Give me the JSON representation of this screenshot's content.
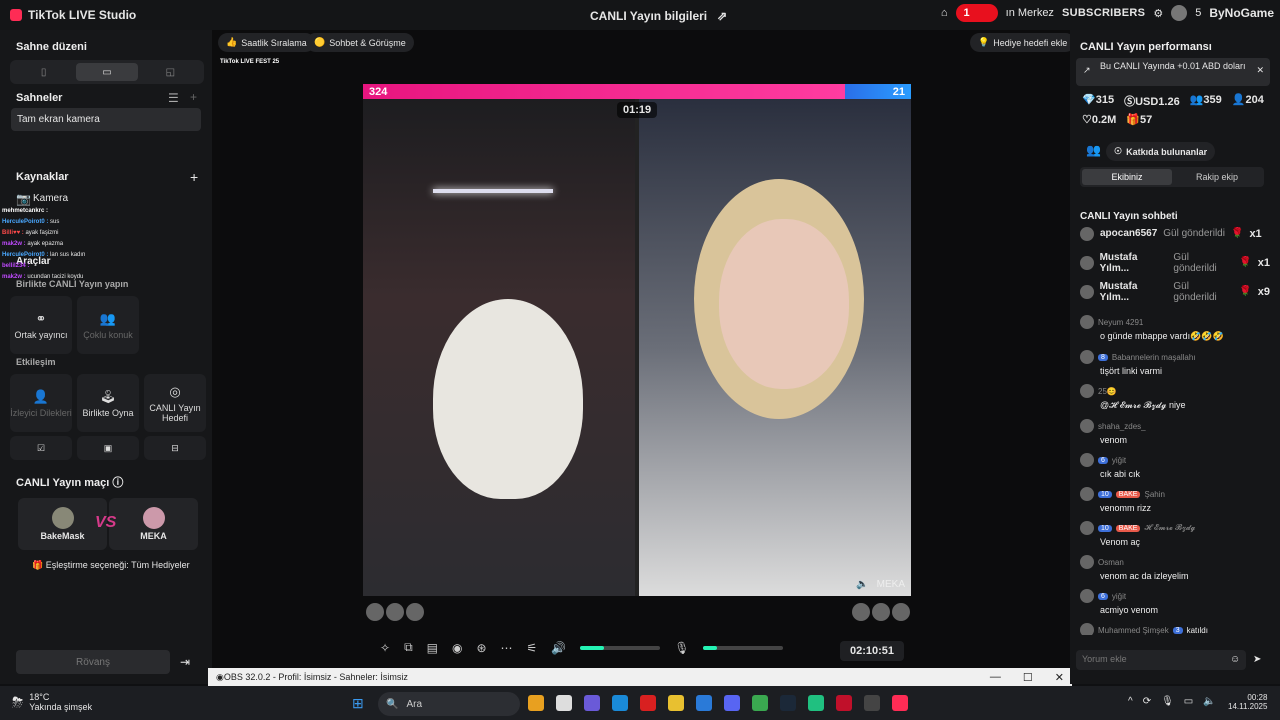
{
  "titlebar": {
    "app": "TikTok LIVE Studio",
    "center": "CANLI Yayın bilgileri",
    "badge_num": "1",
    "merkez": "ın Merkez",
    "subs": "SUBSCRIBERS",
    "right_num": "5",
    "bynogame": "ByNoGame"
  },
  "left": {
    "scene_layout": "Sahne düzeni",
    "scenes": "Sahneler",
    "scene_item": "Tam ekran kamera",
    "sources": "Kaynaklar",
    "camera": "Kamera",
    "tools": "Araçlar",
    "collab": "Birlikte CANLI Yayın yapın",
    "co_host": "Ortak yayıncı",
    "multi_guest": "Çoklu konuk",
    "interaction": "Etkileşim",
    "viewer_requests": "İzleyici Dilekleri",
    "play_together": "Birlikte Oyna",
    "live_goal": "CANLI Yayın Hedefi",
    "match": "CANLI Yayın maçı",
    "p1": "BakeMask",
    "p2": "MEKA",
    "matching": "Eşleştirme seçeneği: Tüm Hediyeler",
    "rematch": "Rövanş"
  },
  "overlay_chat": [
    {
      "n": "mehmetcankrc :",
      "t": ""
    },
    {
      "n": "HerculePoirot0 :",
      "t": "sus"
    },
    {
      "n": "Billi♥♥ :",
      "t": "ayak faşizmi"
    },
    {
      "n": "mak2w :",
      "t": "ayak epazma"
    },
    {
      "n": "HerculePoirot0 :",
      "t": "lan sus kadın"
    },
    {
      "n": "bellil234 :",
      "t": ""
    },
    {
      "n": "mak2w :",
      "t": "ucundan tacizi koydu"
    }
  ],
  "main": {
    "chip1": "Saatlik Sıralama",
    "chip2": "Sohbet & Görüşme",
    "chip3": "Hediye hedefi ekle",
    "fest": "TikTok LIVE FEST 25",
    "score_l": "324",
    "score_r": "21",
    "timer": "01:19",
    "meka": "MEKA",
    "clock": "02:10:51",
    "obs": "OBS 32.0.2 - Profil: İsimsiz - Sahneler: İsimsiz"
  },
  "right": {
    "perf": "CANLI Yayın performansı",
    "info": "Bu CANLI Yayında +0.01 ABD doları",
    "s1": "315",
    "s2": "USD1.26",
    "s3": "359",
    "s4": "204",
    "s5": "0.2M",
    "s6": "57",
    "contrib": "Katkıda bulunanlar",
    "tab1": "Ekibiniz",
    "tab2": "Rakip ekip",
    "chat": "CANLI Yayın sohbeti",
    "gifts": [
      {
        "u": "apocan6567",
        "g": "Gül gönderildi",
        "x": "x1"
      },
      {
        "u": "Mustafa Yılm...",
        "g": "Gül gönderildi",
        "x": "x1"
      },
      {
        "u": "Mustafa Yılm...",
        "g": "Gül gönderildi",
        "x": "x9"
      }
    ],
    "msgs": [
      {
        "n": "Neyum 4291",
        "b": "",
        "t": "o günde mbappe vardı🤣🤣🤣"
      },
      {
        "n": "Babannelerin maşallahı",
        "b": "8",
        "t": "tişört linki varmi"
      },
      {
        "n": "25😊",
        "b": "",
        "t": "@𝓗 𝓔𝓶𝓻𝓮 𝓑𝔃𝓭𝓰 niye"
      },
      {
        "n": "shaha_zdes_",
        "b": "",
        "t": "venom"
      },
      {
        "n": "yiğit",
        "b": "6",
        "t": "cık abi cık"
      },
      {
        "n": "Şahin",
        "b": "10",
        "t": "venomm rizz"
      },
      {
        "n": "𝓗 𝓔𝓶𝓻𝓮 𝓑𝔃𝓭𝓰",
        "b": "10",
        "t": "Venom aç"
      },
      {
        "n": "Osman",
        "b": "",
        "t": "venom ac da izleyelim"
      },
      {
        "n": "yiğit",
        "b": "6",
        "t": "acmiyo venom"
      },
      {
        "n": "Muhammed Şimşek",
        "b": "3",
        "t": "katıldı"
      }
    ],
    "comment": "Yorum ekle"
  },
  "taskbar": {
    "temp": "18°C",
    "weather": "Yakında şimşek",
    "search": "Ara",
    "time": "00:28",
    "date": "14.11.2025"
  }
}
